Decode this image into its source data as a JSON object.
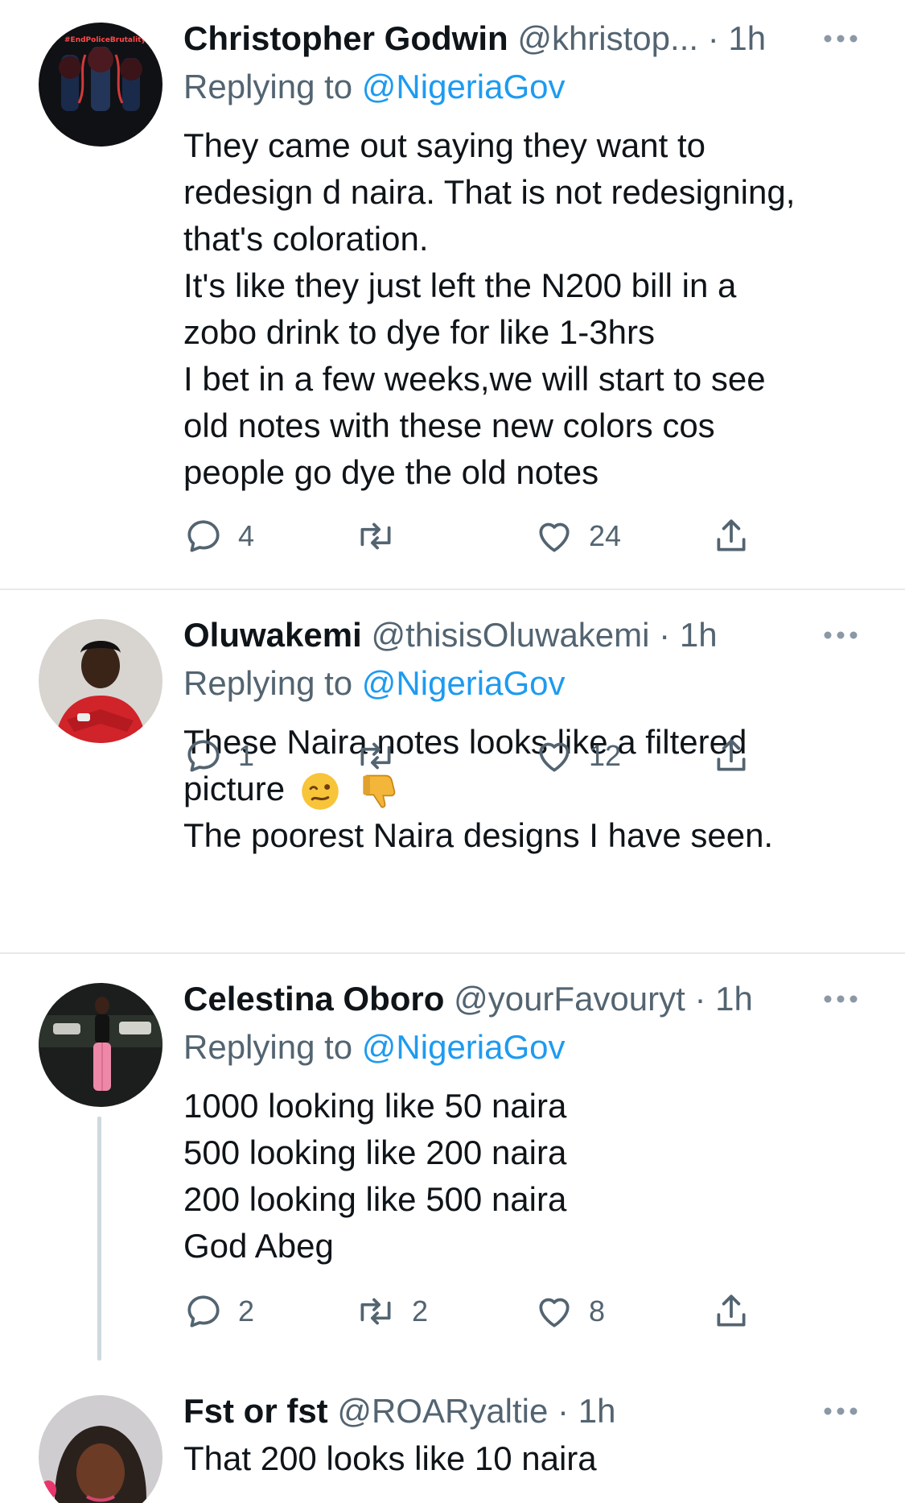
{
  "tweets": [
    {
      "name": "Christopher Godwin",
      "handle": "@khristop...",
      "dot": "·",
      "time": "1h",
      "replying_prefix": "Replying to ",
      "replying_to": "@NigeriaGov",
      "lines": [
        "They came out saying they want to",
        "redesign d naira. That is not redesigning,",
        "that's coloration.",
        "It's like they just left the N200 bill in a",
        "zobo drink to dye for like 1-3hrs",
        "I bet in a few weeks,we will start to see",
        "old notes with these new colors cos",
        "people go dye the old notes"
      ],
      "reply_count": "4",
      "retweet_count": "",
      "like_count": "24",
      "avatar_text": "#EndPoliceBrutality"
    },
    {
      "name": "Oluwakemi",
      "handle": "@thisisOluwakemi",
      "dot": "·",
      "time": "1h",
      "replying_prefix": "Replying to ",
      "replying_to": "@NigeriaGov",
      "line1": "These Naira notes looks like a filtered",
      "line2": "picture",
      "line3": "The poorest Naira designs I have seen.",
      "emojis": [
        "woozy-face-emoji",
        "thumbs-down-emoji"
      ],
      "reply_count": "1",
      "retweet_count": "",
      "like_count": "12"
    },
    {
      "name": "Celestina Oboro",
      "handle": "@yourFavouryt",
      "dot": "·",
      "time": "1h",
      "replying_prefix": "Replying to ",
      "replying_to": "@NigeriaGov",
      "lines": [
        "1000 looking like 50 naira",
        "500 looking like 200 naira",
        "200 looking like 500 naira",
        "God Abeg"
      ],
      "reply_count": "2",
      "retweet_count": "2",
      "like_count": "8"
    },
    {
      "name": "Fst or fst",
      "handle": "@ROARyaltie",
      "dot": "·",
      "time": "1h",
      "text": "That 200 looks like 10 naira"
    }
  ],
  "icons": {
    "reply": "reply-icon",
    "retweet": "retweet-icon",
    "like": "heart-icon",
    "share": "share-icon",
    "more": "more-icon"
  },
  "colors": {
    "link": "#1d9bf0",
    "secondary_text": "#536471",
    "divider": "#e6e9eb"
  }
}
